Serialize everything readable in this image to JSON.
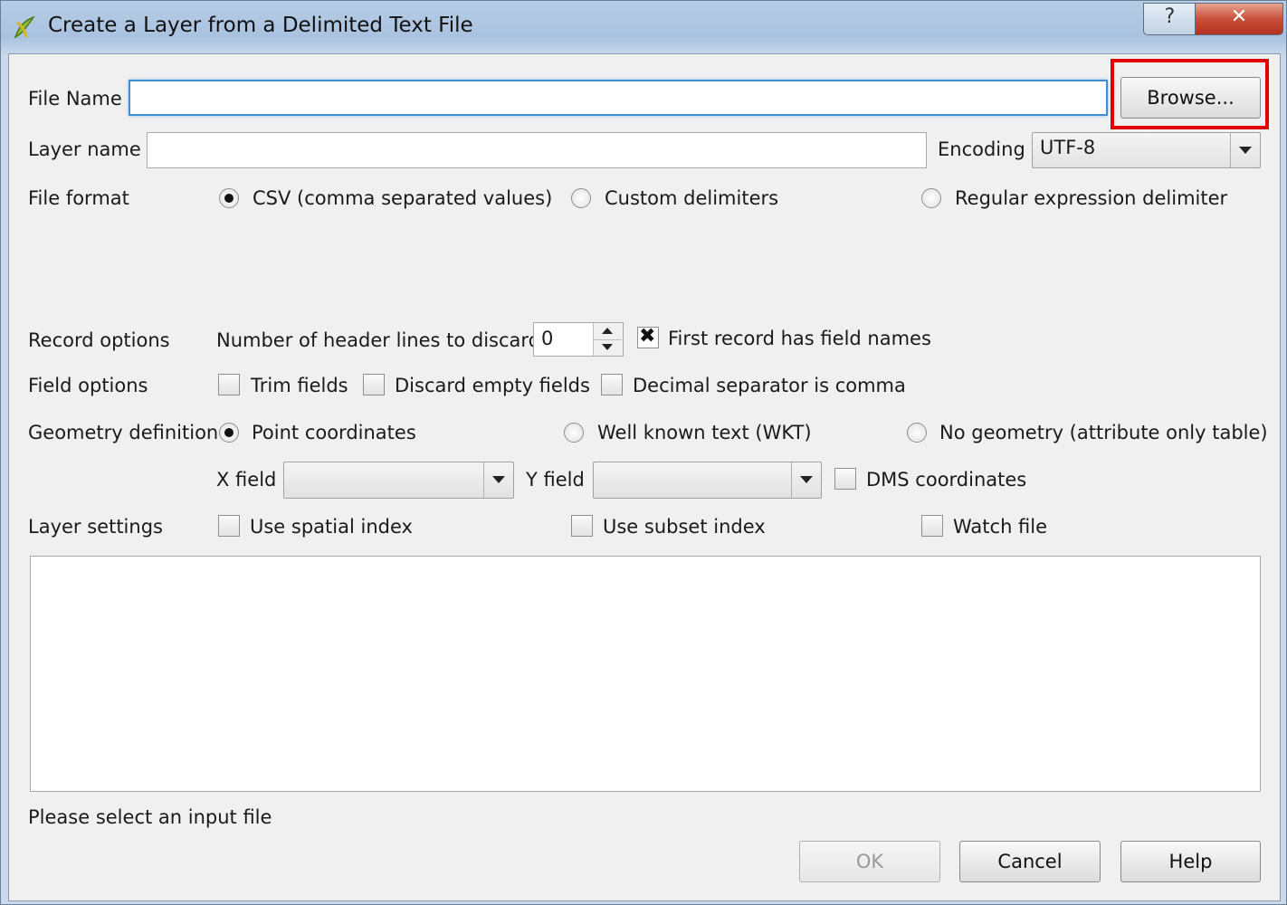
{
  "window": {
    "title": "Create a Layer from a Delimited Text File",
    "help_button": "?",
    "close_button": "✕"
  },
  "file_name": {
    "label": "File Name",
    "value": "",
    "browse_label": "Browse..."
  },
  "layer_name": {
    "label": "Layer name",
    "value": ""
  },
  "encoding": {
    "label": "Encoding",
    "value": "UTF-8"
  },
  "file_format": {
    "label": "File format",
    "options": [
      "CSV (comma separated values)",
      "Custom delimiters",
      "Regular expression delimiter"
    ],
    "selected": "CSV (comma separated values)"
  },
  "record_options": {
    "label": "Record options",
    "header_lines_label": "Number of header lines to discard",
    "header_lines_value": "0",
    "first_record_label": "First record has field names",
    "first_record_checked": true
  },
  "field_options": {
    "label": "Field options",
    "trim_fields": "Trim fields",
    "discard_empty": "Discard empty fields",
    "decimal_comma": "Decimal separator is comma"
  },
  "geometry": {
    "label": "Geometry definition",
    "options": [
      "Point coordinates",
      "Well known text (WKT)",
      "No geometry (attribute only table)"
    ],
    "selected": "Point coordinates",
    "x_field_label": "X field",
    "x_field_value": "",
    "y_field_label": "Y field",
    "y_field_value": "",
    "dms_label": "DMS coordinates"
  },
  "layer_settings": {
    "label": "Layer settings",
    "spatial_index": "Use spatial index",
    "subset_index": "Use subset index",
    "watch_file": "Watch file"
  },
  "status": "Please select an input file",
  "buttons": {
    "ok": "OK",
    "cancel": "Cancel",
    "help": "Help"
  }
}
